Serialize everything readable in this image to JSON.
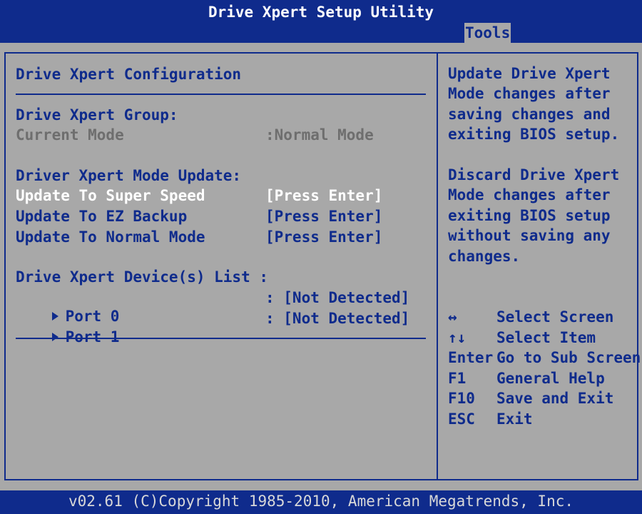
{
  "title": "Drive Xpert Setup Utility",
  "menu": {
    "active_tab": "Tools"
  },
  "main": {
    "section_title": "Drive Xpert Configuration",
    "group": {
      "heading": "Drive Xpert Group:",
      "current_mode_label": "Current Mode",
      "current_mode_value": ":Normal Mode"
    },
    "update": {
      "heading": "Driver Xpert Mode Update:",
      "items": [
        {
          "label": "Update To Super Speed",
          "value": "[Press Enter]"
        },
        {
          "label": "Update To EZ Backup",
          "value": "[Press Enter]"
        },
        {
          "label": "Update To Normal Mode",
          "value": "[Press Enter]"
        }
      ]
    },
    "devices": {
      "heading": "Drive Xpert Device(s) List :",
      "items": [
        {
          "label": "Port 0",
          "value": ": [Not Detected]"
        },
        {
          "label": "Port 1",
          "value": ": [Not Detected]"
        }
      ]
    }
  },
  "help": {
    "lines": [
      "Update Drive Xpert",
      "Mode changes after",
      "saving changes and",
      "exiting BIOS setup.",
      "",
      "Discard Drive Xpert",
      "Mode changes after",
      "exiting BIOS setup",
      "without saving any",
      "changes."
    ],
    "keys": [
      {
        "key": "↔",
        "desc": "Select Screen"
      },
      {
        "key": "↑↓",
        "desc": "Select Item"
      },
      {
        "key": "Enter",
        "desc": "Go to Sub Screen"
      },
      {
        "key": "F1",
        "desc": "General Help"
      },
      {
        "key": "F10",
        "desc": "Save and Exit"
      },
      {
        "key": "ESC",
        "desc": "Exit"
      }
    ]
  },
  "footer": "v02.61 (C)Copyright 1985-2010, American Megatrends, Inc.",
  "colors": {
    "background": "#a8a8a8",
    "bar": "#0f2b8c",
    "text": "#0f2b8c",
    "selected": "#ffffff",
    "disabled": "#6e6e6e"
  }
}
